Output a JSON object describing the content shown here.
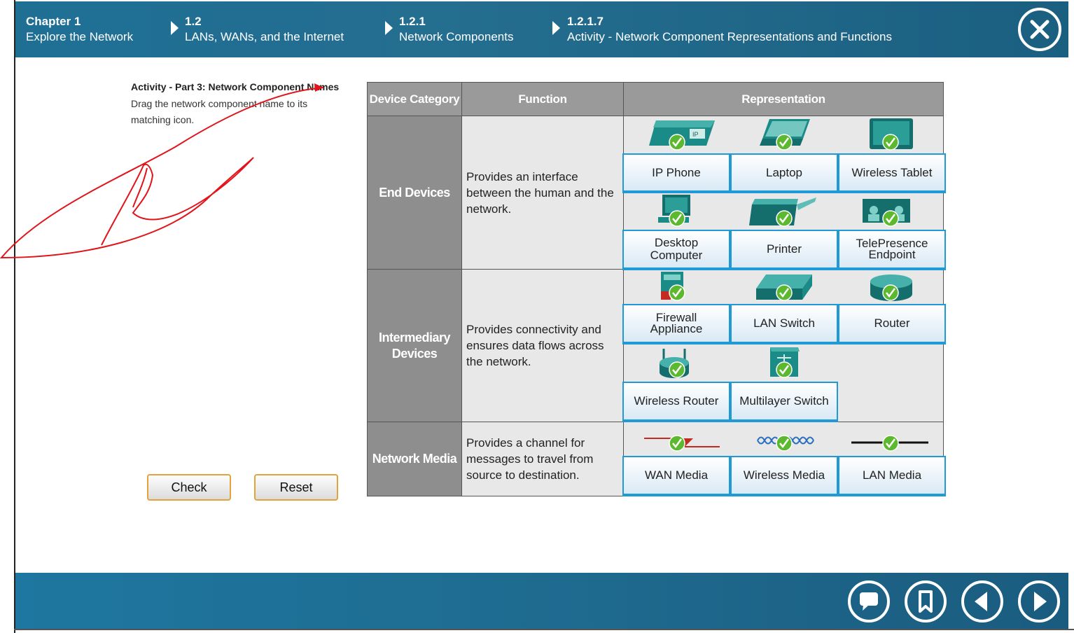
{
  "header": {
    "crumbs": [
      {
        "num": "Chapter 1",
        "label": "Explore the Network"
      },
      {
        "num": "1.2",
        "label": "LANs, WANs, and the Internet"
      },
      {
        "num": "1.2.1",
        "label": "Network Components"
      },
      {
        "num": "1.2.1.7",
        "label": "Activity - Network Component Representations and Functions"
      }
    ]
  },
  "instructions": {
    "title": "Activity - Part 3: Network Component Names",
    "text": "Drag the network component name to its matching icon."
  },
  "buttons": {
    "check": "Check",
    "reset": "Reset"
  },
  "table": {
    "headers": {
      "category": "Device Category",
      "function": "Function",
      "representation": "Representation"
    },
    "rows": [
      {
        "category": "End Devices",
        "function": "Provides an interface between the human and the network.",
        "labels": [
          "IP Phone",
          "Laptop",
          "Wireless Tablet",
          "Desktop Computer",
          "Printer",
          "TelePresence Endpoint"
        ]
      },
      {
        "category": "Intermediary Devices",
        "function": "Provides connectivity and ensures data flows across the network.",
        "labels": [
          "Firewall Appliance",
          "LAN Switch",
          "Router",
          "Wireless Router",
          "Multilayer Switch"
        ]
      },
      {
        "category": "Network Media",
        "function": "Provides a channel for messages to travel from source to destination.",
        "labels": [
          "WAN Media",
          "Wireless Media",
          "LAN Media"
        ]
      }
    ]
  },
  "colors": {
    "header": "#1f6f95",
    "footer": "#1e77a0",
    "label_border": "#1f9ad6",
    "check": "#5cb82e",
    "device": "#1a8a8a",
    "scribble": "#e0141a"
  },
  "icons": [
    "close-icon",
    "comment-icon",
    "bookmark-icon",
    "previous-icon",
    "next-icon",
    "check-icon"
  ]
}
